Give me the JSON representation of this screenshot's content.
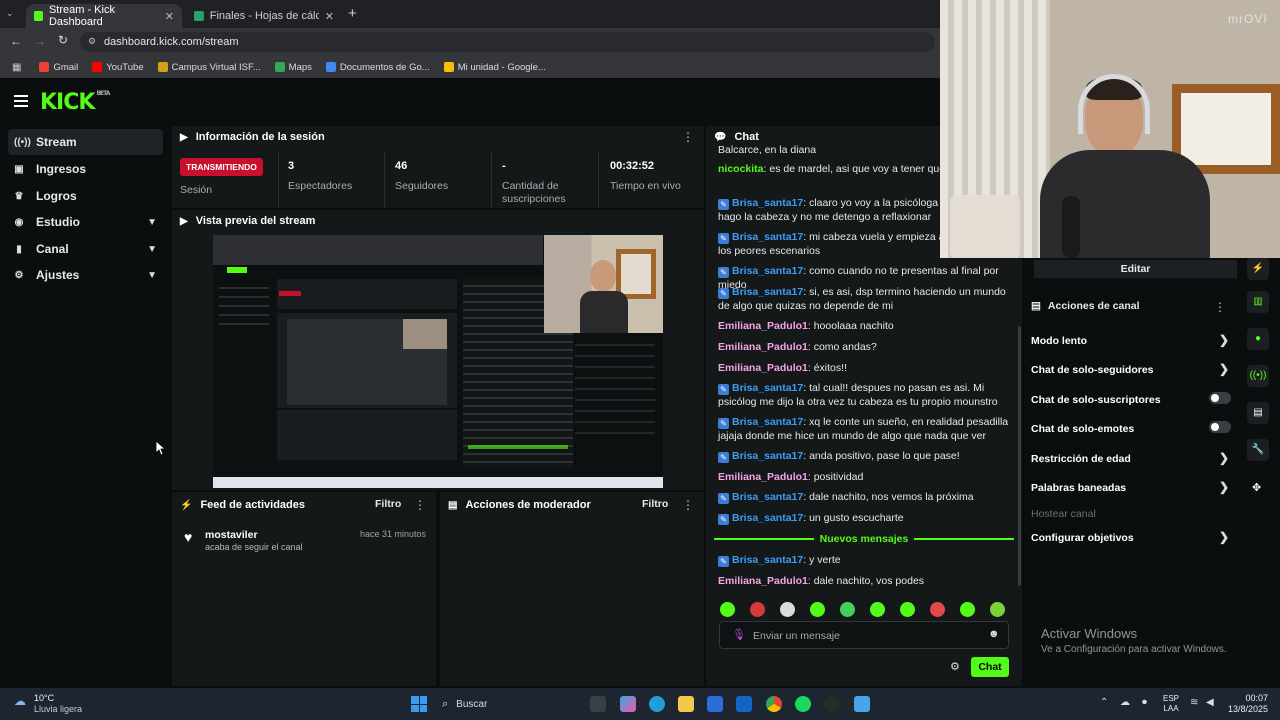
{
  "browser": {
    "tabs": [
      {
        "title": "Stream - Kick Dashboard",
        "active": true
      },
      {
        "title": "Finales - Hojas de cálculo de G",
        "active": false
      }
    ],
    "url": "dashboard.kick.com/stream",
    "bookmarks": [
      "Gmail",
      "YouTube",
      "Campus Virtual ISF...",
      "Maps",
      "Documentos de Go...",
      "Mi unidad - Google..."
    ]
  },
  "brand": {
    "logo": "KICK",
    "logo_tag": "BETA",
    "accent": "#53fc18"
  },
  "sidebar": {
    "items": [
      {
        "label": "Stream",
        "icon": "broadcast-icon"
      },
      {
        "label": "Ingresos",
        "icon": "revenue-icon"
      },
      {
        "label": "Logros",
        "icon": "trophy-icon"
      },
      {
        "label": "Estudio",
        "icon": "studio-icon"
      },
      {
        "label": "Canal",
        "icon": "channel-icon"
      },
      {
        "label": "Ajustes",
        "icon": "gear-icon"
      }
    ]
  },
  "session": {
    "title": "Información de la sesión",
    "status": "TRANSMITIENDO",
    "status_label": "Sesión",
    "viewers": "3",
    "viewers_label": "Espectadores",
    "followers": "46",
    "followers_label": "Seguidores",
    "subs": "-",
    "subs_label": "Cantidad de suscripciones",
    "uptime": "00:32:52",
    "uptime_label": "Tiempo en vivo"
  },
  "preview": {
    "title": "Vista previa del stream"
  },
  "activity": {
    "title": "Feed de actividades",
    "filter": "Filtro",
    "user": "mostaviler",
    "action": "acaba de seguir el canal",
    "time": "hace 31 minutos"
  },
  "mod": {
    "title": "Acciones de moderador",
    "filter": "Filtro"
  },
  "chat": {
    "title": "Chat",
    "messages": [
      {
        "user": "",
        "text": "Balcarce, en la diana"
      },
      {
        "user": "nicockita",
        "text": "es de mardel, asi que voy a tener que ir ma alla"
      },
      {
        "user": "Brisa_santa17",
        "text": "claaro yo voy a la psicóloga justam me hago la cabeza y no me detengo a reflaxionar"
      },
      {
        "user": "Brisa_santa17",
        "text": "mi cabeza vuela y empieza a pensa todos los peores escenarios"
      },
      {
        "user": "Brisa_santa17",
        "text": "como cuando no te presentas al final por miedo"
      },
      {
        "user": "Brisa_santa17",
        "text": "si, es asi, dsp termino haciendo un mundo de algo que quizas no depende de mi"
      },
      {
        "user": "Emiliana_Padulo1",
        "text": "hooolaaa nachito"
      },
      {
        "user": "Emiliana_Padulo1",
        "text": "como andas?"
      },
      {
        "user": "Emiliana_Padulo1",
        "text": "éxitos!!"
      },
      {
        "user": "Brisa_santa17",
        "text": "tal cual!! despues no pasan es asi. Mi psicólog me dijo la otra vez tu cabeza es tu propio mounstro"
      },
      {
        "user": "Brisa_santa17",
        "text": "xq le conte un sueño, en realidad pesadilla jajaja donde me hice un mundo de algo que nada que ver"
      },
      {
        "user": "Brisa_santa17",
        "text": "anda positivo, pase lo que pase!"
      },
      {
        "user": "Emiliana_Padulo1",
        "text": "positividad"
      },
      {
        "user": "Brisa_santa17",
        "text": "dale nachito, nos vemos la próxima"
      },
      {
        "user": "Brisa_santa17",
        "text": "un gusto escucharte"
      },
      {
        "user": "Brisa_santa17",
        "text": "y verte"
      },
      {
        "user": "Emiliana_Padulo1",
        "text": "dale nachito, vos podes"
      }
    ],
    "new_messages": "Nuevos mensajes",
    "placeholder": "Enviar un mensaje",
    "send": "Chat"
  },
  "channel": {
    "edit": "Editar",
    "title": "Acciones de canal",
    "items": [
      {
        "label": "Modo lento",
        "kind": "arrow"
      },
      {
        "label": "Chat de solo-seguidores",
        "kind": "arrow"
      },
      {
        "label": "Chat de solo-suscriptores",
        "kind": "toggle"
      },
      {
        "label": "Chat de solo-emotes",
        "kind": "toggle"
      },
      {
        "label": "Restricción de edad",
        "kind": "arrow"
      },
      {
        "label": "Palabras baneadas",
        "kind": "arrow"
      },
      {
        "label": "Hostear canal",
        "kind": "disabled"
      },
      {
        "label": "Configurar objetivos",
        "kind": "arrow"
      }
    ]
  },
  "watermark": {
    "line1": "Activar Windows",
    "line2": "Ve a Configuración para activar Windows."
  },
  "cam_watermark": "mrOVI",
  "taskbar": {
    "weather_temp": "10°C",
    "weather_desc": "Lluvia ligera",
    "search": "Buscar",
    "lang": "ESP",
    "lang2": "LAA",
    "time": "00:07",
    "date": "13/8/2025"
  }
}
